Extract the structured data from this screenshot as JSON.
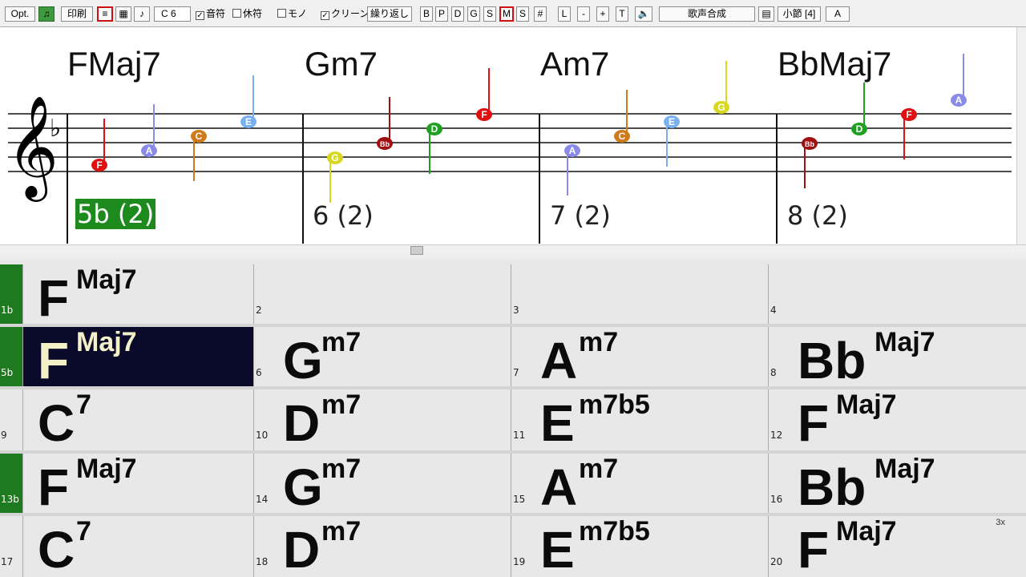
{
  "toolbar": {
    "opt": "Opt.",
    "print": "印刷",
    "key": "C 6",
    "notes_check": "音符",
    "rest_check": "休符",
    "mono_check": "モノ",
    "clean_check": "クリーン",
    "repeat": "繰り返し",
    "tracks": [
      "B",
      "P",
      "D",
      "G",
      "S",
      "M",
      "S",
      "#"
    ],
    "l": "L",
    "minus": "-",
    "plus": "+",
    "t": "T",
    "voice": "歌声合成",
    "bars": "小節 [4]"
  },
  "notation": {
    "chords": [
      "FMaj7",
      "Gm7",
      "Am7",
      "BbMaj7"
    ],
    "bar_labels": [
      "5b (2)",
      "6 (2)",
      "7 (2)",
      "8 (2)"
    ],
    "note_letters": [
      [
        "F",
        "A",
        "C",
        "E"
      ],
      [
        "G",
        "Bb",
        "D",
        "F"
      ],
      [
        "A",
        "C",
        "E",
        "G"
      ],
      [
        "Bb",
        "D",
        "F",
        "A"
      ]
    ],
    "note_colors": {
      "F": "#e01010",
      "A": "#8a8ae8",
      "C": "#d07a1a",
      "E": "#7ab0f0",
      "G": "#d8d820",
      "Bb": "#a01010",
      "D": "#20a020"
    }
  },
  "grid": {
    "rows": [
      [
        {
          "root": "F",
          "ext": "Maj7",
          "num": "1b"
        },
        {
          "root": "",
          "ext": "",
          "num": "2"
        },
        {
          "root": "",
          "ext": "",
          "num": "3"
        },
        {
          "root": "",
          "ext": "",
          "num": "4"
        }
      ],
      [
        {
          "root": "F",
          "ext": "Maj7",
          "num": "5b"
        },
        {
          "root": "G",
          "ext": "m7",
          "num": "6"
        },
        {
          "root": "A",
          "ext": "m7",
          "num": "7"
        },
        {
          "root": "Bb",
          "ext": "Maj7",
          "num": "8"
        }
      ],
      [
        {
          "root": "C",
          "ext": "7",
          "num": "9"
        },
        {
          "root": "D",
          "ext": "m7",
          "num": "10"
        },
        {
          "root": "E",
          "ext": "m7b5",
          "num": "11"
        },
        {
          "root": "F",
          "ext": "Maj7",
          "num": "12"
        }
      ],
      [
        {
          "root": "F",
          "ext": "Maj7",
          "num": "13b"
        },
        {
          "root": "G",
          "ext": "m7",
          "num": "14"
        },
        {
          "root": "A",
          "ext": "m7",
          "num": "15"
        },
        {
          "root": "Bb",
          "ext": "Maj7",
          "num": "16"
        }
      ],
      [
        {
          "root": "C",
          "ext": "7",
          "num": "17"
        },
        {
          "root": "D",
          "ext": "m7",
          "num": "18"
        },
        {
          "root": "E",
          "ext": "m7b5",
          "num": "19"
        },
        {
          "root": "F",
          "ext": "Maj7",
          "num": "20"
        }
      ]
    ],
    "repeat_mark": "3x"
  }
}
